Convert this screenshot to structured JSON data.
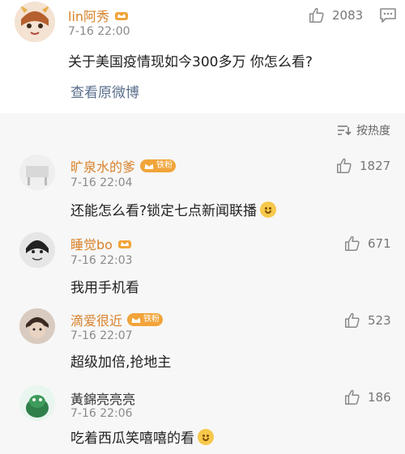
{
  "post": {
    "user": "lin阿秀",
    "time": "7-16 22:00",
    "text": "关于美国疫情现如今300多万 你怎么看?",
    "likes": "2083",
    "view_original": "查看原微博"
  },
  "sort_label": "按热度",
  "comments": [
    {
      "user": "旷泉水的爹",
      "badge": "铁粉",
      "time": "7-16 22:04",
      "text": "还能怎么看?锁定七点新闻联播",
      "likes": "1827"
    },
    {
      "user": "睡觉bo",
      "badge": "",
      "time": "7-16 22:03",
      "text": "我用手机看",
      "likes": "671"
    },
    {
      "user": "滴爱很近",
      "badge": "铁粉",
      "time": "7-16 22:07",
      "text": "超级加倍,抢地主",
      "likes": "523"
    },
    {
      "user": "黃錦亮亮亮",
      "badge": "",
      "time": "7-16 22:06",
      "text": "吃着西瓜笑嘻嘻的看",
      "likes": "186"
    }
  ],
  "colors": {
    "username": "#d9822b",
    "link": "#5a6f8c",
    "badge": "#f1a43a"
  }
}
